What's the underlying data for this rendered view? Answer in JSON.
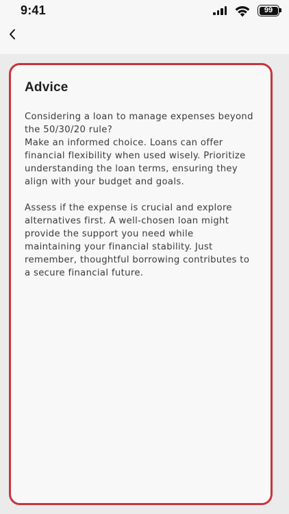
{
  "status_bar": {
    "time": "9:41",
    "battery_level": "99",
    "icons": [
      "cellular-signal-icon",
      "wifi-icon",
      "battery-icon"
    ]
  },
  "nav": {
    "back_icon": "chevron-left-icon"
  },
  "advice": {
    "title": "Advice",
    "paragraphs": [
      "Considering a loan to manage expenses beyond\nthe 50/30/20 rule?\nMake an informed choice. Loans can offer\nfinancial flexibility when used wisely. Prioritize\nunderstanding the loan terms, ensuring they\nalign with your budget and goals.",
      "Assess if the expense is crucial and explore\nalternatives first. A well-chosen loan might\nprovide the support you need while\nmaintaining your financial stability. Just\nremember, thoughtful borrowing contributes to\na secure financial future."
    ]
  },
  "colors": {
    "card_border": "#c8333d",
    "background": "#ebebeb",
    "card_background": "#f8f8f8"
  }
}
